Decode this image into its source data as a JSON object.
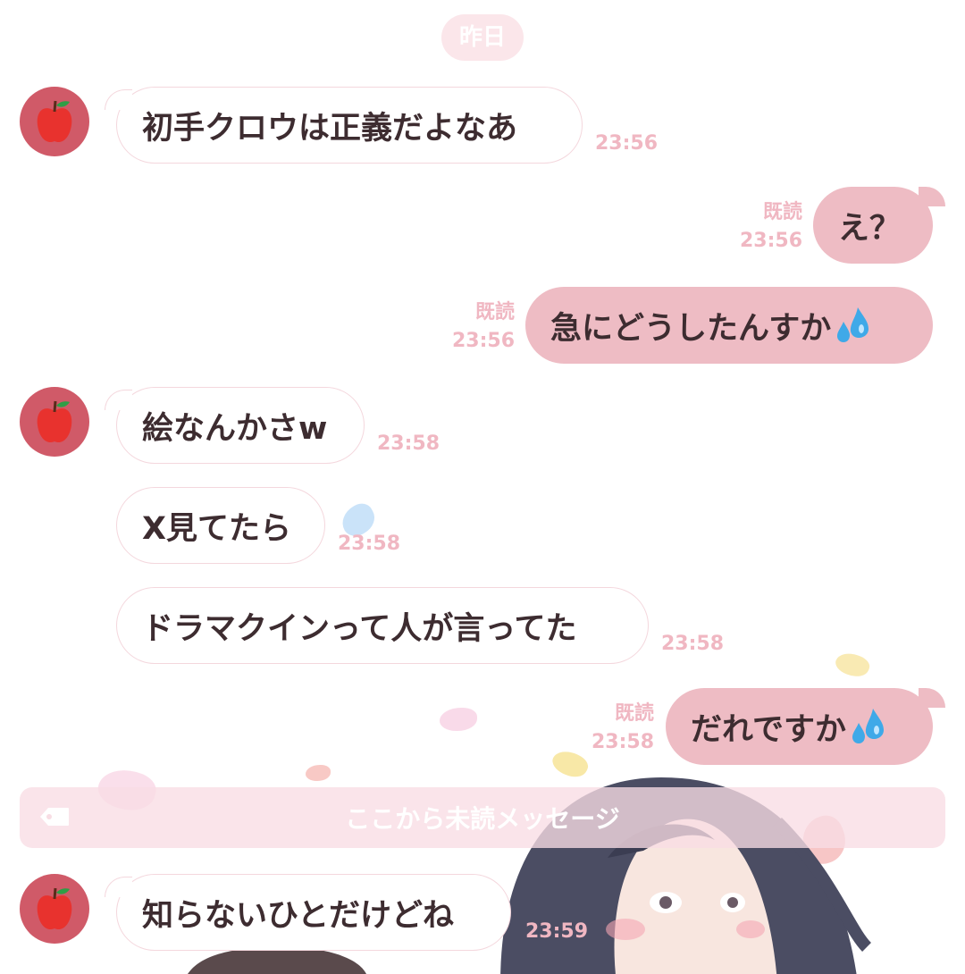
{
  "date_divider": "昨日",
  "unread_divider": "ここから未読メッセージ",
  "read_label": "既読",
  "messages": [
    {
      "text": "初手クロウは正義だよなあ",
      "time": "23:56"
    },
    {
      "text": "え？",
      "time": "23:56"
    },
    {
      "text": "急にどうしたんすか",
      "time": "23:56"
    },
    {
      "text": "絵なんかさw",
      "time": "23:58"
    },
    {
      "text": "X見てたら",
      "time": "23:58"
    },
    {
      "text": "ドラマクインって人が言ってた",
      "time": "23:58"
    },
    {
      "text": "だれですか",
      "time": "23:58"
    },
    {
      "text": "知らないひとだけどね",
      "time": "23:59"
    }
  ],
  "icons": {
    "avatar": "apple-icon",
    "sweat": "sweat-drops-icon",
    "unread": "tag-icon"
  },
  "colors": {
    "outgoing_bubble": "#eebcc4",
    "incoming_border": "#f4d7dd",
    "meta_text": "#f0b7c2",
    "avatar": "#d05a68"
  }
}
